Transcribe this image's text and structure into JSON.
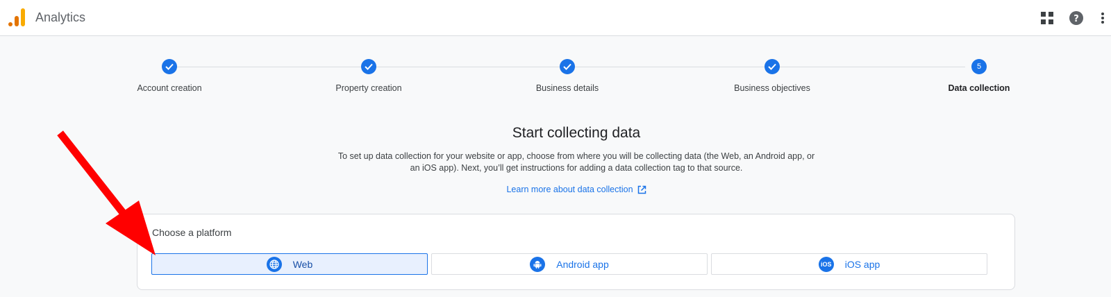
{
  "app": {
    "title": "Analytics"
  },
  "header_icons": [
    "apps-grid-icon",
    "help-icon",
    "more-vert-icon"
  ],
  "stepper": {
    "steps": [
      {
        "label": "Account creation",
        "state": "done"
      },
      {
        "label": "Property creation",
        "state": "done"
      },
      {
        "label": "Business details",
        "state": "done"
      },
      {
        "label": "Business objectives",
        "state": "done"
      },
      {
        "label": "Data collection",
        "state": "active",
        "number": "5"
      }
    ]
  },
  "main": {
    "heading": "Start collecting data",
    "description": "To set up data collection for your website or app, choose from where you will be collecting data (the Web, an Android app, or an iOS app). Next, you’ll get instructions for adding a data collection tag to that source.",
    "learn_more": "Learn more about data collection"
  },
  "platform": {
    "title": "Choose a platform",
    "options": [
      {
        "label": "Web",
        "icon": "globe-icon",
        "selected": true
      },
      {
        "label": "Android app",
        "icon": "android-icon",
        "selected": false
      },
      {
        "label": "iOS app",
        "icon": "ios-icon",
        "icon_text": "iOS",
        "selected": false
      }
    ]
  },
  "colors": {
    "accent": "#1a73e8",
    "annotation_arrow": "#ff0000",
    "logo_orange": "#f9ab00",
    "logo_dark_orange": "#e37400"
  }
}
